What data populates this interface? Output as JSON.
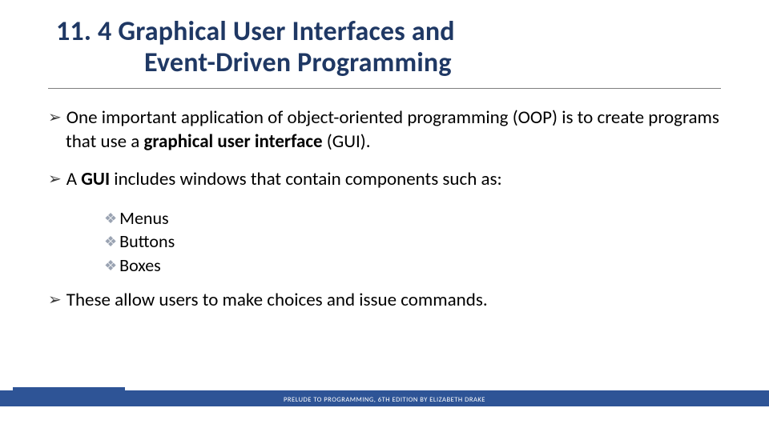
{
  "title": {
    "line1": "11. 4 Graphical User Interfaces and",
    "line2": "Event-Driven Programming"
  },
  "bullets": {
    "b1_pre": "One important application of object-oriented programming (OOP) is to create programs that use a ",
    "b1_bold": "graphical user interface",
    "b1_post": " (GUI).",
    "b2_pre": "A ",
    "b2_bold": "GUI",
    "b2_post": " includes windows that contain components such as:",
    "sub1": "Menus",
    "sub2": "Buttons",
    "sub3": "Boxes",
    "b3": "These allow users to make choices and issue commands."
  },
  "footer": "PRELUDE TO PROGRAMMING, 6TH EDITION BY ELIZABETH DRAKE"
}
